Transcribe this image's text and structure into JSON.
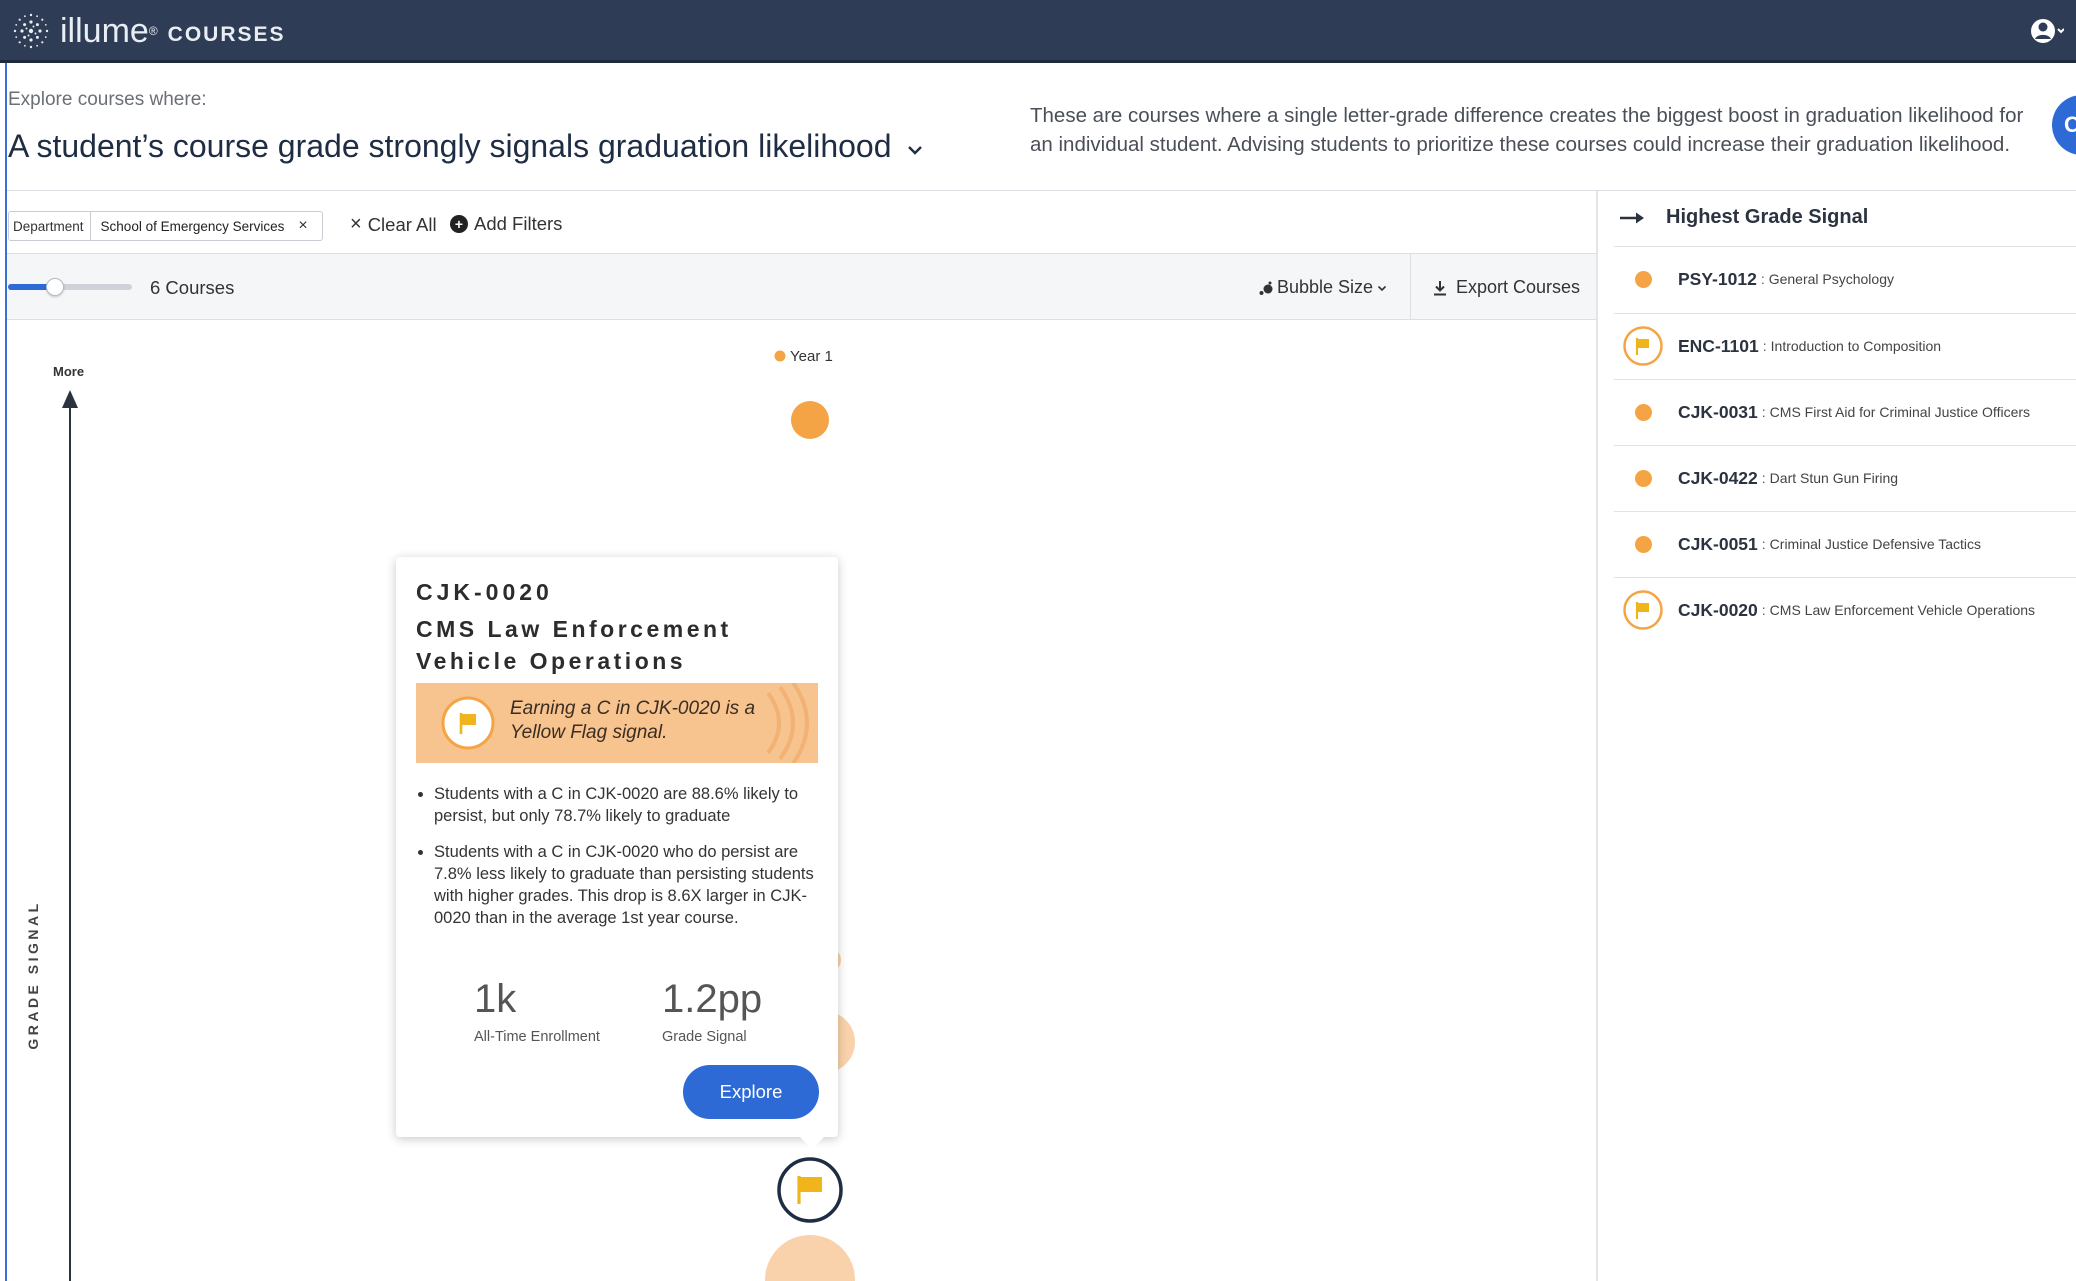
{
  "app": {
    "brand_name": "illume",
    "brand_mark": "®",
    "brand_product": "COURSES",
    "icons": {
      "logo": "starburst-logo-icon",
      "user": "user-account-icon"
    }
  },
  "header": {
    "explore_label": "Explore courses where:",
    "headline": "A student’s course grade strongly signals graduation likelihood",
    "description": "These are courses where a single letter-grade difference creates the biggest boost in graduation likelihood for an individual student. Advising students to prioritize these courses could increase their graduation likelihood.",
    "blue_button_letter": "C"
  },
  "filters": {
    "chip_key": "Department",
    "chip_value": "School of Emergency Services",
    "chip_remove": "×",
    "clear_all": "Clear All",
    "add_filters": "Add Filters"
  },
  "controls": {
    "slider_value": 0.38,
    "course_count": "6 Courses",
    "bubble_size": "Bubble Size",
    "export_courses": "Export Courses"
  },
  "chart": {
    "legend_label": "Year 1",
    "y_axis_top_label": "More",
    "y_axis_title": "GRADE SIGNAL",
    "colors": {
      "bubble": "#f5a445",
      "bubble_light": "#f9d2ab",
      "flag": "#f1b51c",
      "flag_ring": "#1f2d44"
    }
  },
  "tooltip": {
    "code": "CJK-0020",
    "title": "CMS Law Enforcement Vehicle Operations",
    "flag_text": "Earning a C in CJK-0020 is a Yellow Flag signal.",
    "bullets": [
      "Students with a C in CJK-0020 are 88.6% likely to persist, but only 78.7% likely to graduate",
      "Students with a C in CJK-0020 who do persist are 7.8% less likely to graduate than persisting students with higher grades. This drop is 8.6X larger in CJK-0020 than in the average 1st year course."
    ],
    "stat1_value": "1k",
    "stat1_label": "All-Time Enrollment",
    "stat2_value": "1.2pp",
    "stat2_label": "Grade Signal",
    "explore_button": "Explore"
  },
  "right_panel": {
    "title": "Highest Grade Signal",
    "items": [
      {
        "code": "PSY-1012",
        "name": "General Psychology",
        "flagged": false
      },
      {
        "code": "ENC-1101",
        "name": "Introduction to Composition",
        "flagged": true
      },
      {
        "code": "CJK-0031",
        "name": "CMS First Aid for Criminal Justice Officers",
        "flagged": false
      },
      {
        "code": "CJK-0422",
        "name": "Dart Stun Gun Firing",
        "flagged": false
      },
      {
        "code": "CJK-0051",
        "name": "Criminal Justice Defensive Tactics",
        "flagged": false
      },
      {
        "code": "CJK-0020",
        "name": "CMS Law Enforcement Vehicle Operations",
        "flagged": true
      }
    ],
    "separator": ":"
  }
}
